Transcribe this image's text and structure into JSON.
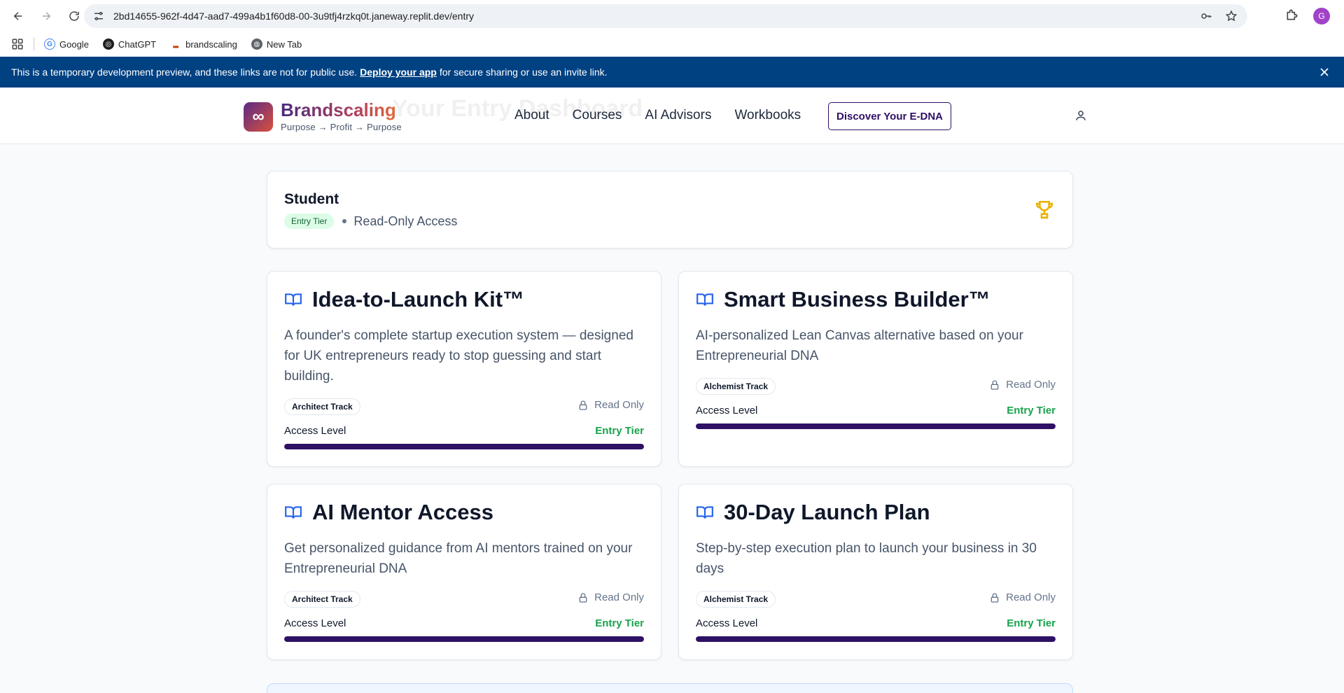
{
  "browser": {
    "url": "2bd14655-962f-4d47-aad7-499a4b1f60d8-00-3u9tfj4rzkq0t.janeway.replit.dev/entry",
    "profile_initial": "G",
    "bookmarks": [
      {
        "label": "Google",
        "icon": "google-icon"
      },
      {
        "label": "ChatGPT",
        "icon": "chatgpt-icon"
      },
      {
        "label": "brandscaling",
        "icon": "brandscaling-favicon"
      },
      {
        "label": "New Tab",
        "icon": "globe-icon"
      }
    ]
  },
  "banner": {
    "text_before": "This is a temporary development preview, and these links are not for public use.",
    "link": "Deploy your app",
    "text_after": "for secure sharing or use an invite link."
  },
  "header": {
    "brand": "Brandscaling",
    "tagline": "Purpose → Profit → Purpose",
    "ghost_title": "Your Entry Dashboard",
    "nav": [
      "About",
      "Courses",
      "AI Advisors",
      "Workbooks"
    ],
    "cta": "Discover Your E-DNA"
  },
  "student": {
    "title": "Student",
    "tier": "Entry Tier",
    "access": "Read-Only Access"
  },
  "tiles": [
    {
      "title": "Idea-to-Launch Kit™",
      "description": "A founder's complete startup execution system — designed for UK entrepreneurs ready to stop guessing and start building.",
      "track": "Architect Track",
      "status": "Read Only",
      "access_label": "Access Level",
      "access_value": "Entry Tier",
      "progress": 1.0
    },
    {
      "title": "Smart Business Builder™",
      "description": "AI-personalized Lean Canvas alternative based on your Entrepreneurial DNA",
      "track": "Alchemist Track",
      "status": "Read Only",
      "access_label": "Access Level",
      "access_value": "Entry Tier",
      "progress": 1.0
    },
    {
      "title": "AI Mentor Access",
      "description": "Get personalized guidance from AI mentors trained on your Entrepreneurial DNA",
      "track": "Architect Track",
      "status": "Read Only",
      "access_label": "Access Level",
      "access_value": "Entry Tier",
      "progress": 1.0
    },
    {
      "title": "30-Day Launch Plan",
      "description": "Step-by-step execution plan to launch your business in 30 days",
      "track": "Alchemist Track",
      "status": "Read Only",
      "access_label": "Access Level",
      "access_value": "Entry Tier",
      "progress": 1.0
    }
  ],
  "colors": {
    "banner": "#004182",
    "brand_dark": "#2e1065",
    "accent_green": "#16a34a",
    "book_icon": "#2563eb",
    "trophy": "#eab308"
  }
}
